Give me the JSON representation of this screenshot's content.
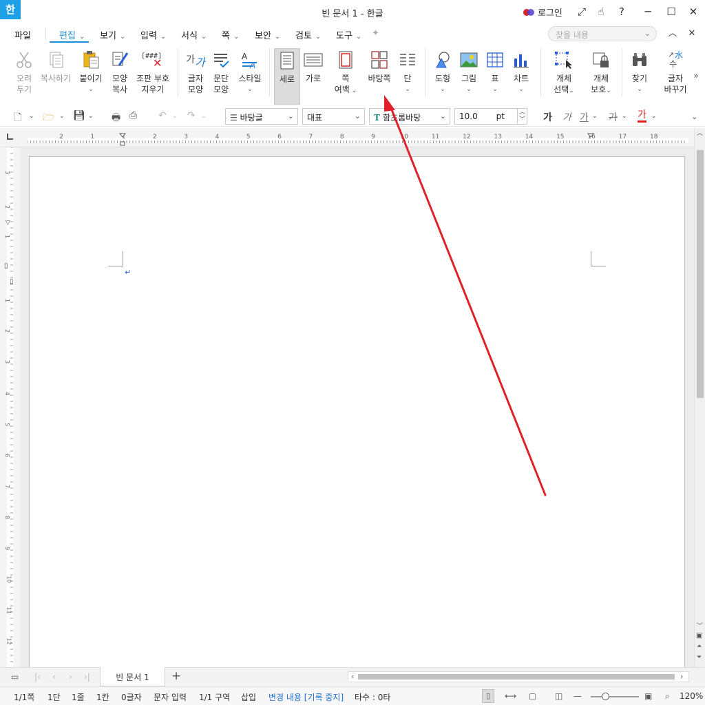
{
  "app": {
    "icon_text": "한",
    "title": "빈 문서 1 - 한글",
    "login": "로그인"
  },
  "menus": [
    {
      "label": "파일",
      "chevron": false
    },
    {
      "label": "편집",
      "chevron": true,
      "active": true
    },
    {
      "label": "보기",
      "chevron": true
    },
    {
      "label": "입력",
      "chevron": true
    },
    {
      "label": "서식",
      "chevron": true
    },
    {
      "label": "쪽",
      "chevron": true
    },
    {
      "label": "보안",
      "chevron": true
    },
    {
      "label": "검토",
      "chevron": true
    },
    {
      "label": "도구",
      "chevron": true
    }
  ],
  "search": {
    "placeholder": "찾을 내용"
  },
  "ribbon": {
    "cut": {
      "line1": "오려",
      "line2": "두기"
    },
    "copy": "복사하기",
    "paste": {
      "line1": "붙이기"
    },
    "format_copy": {
      "line1": "모양",
      "line2": "복사"
    },
    "clear_codes": {
      "line1": "조판 부호",
      "line2": "지우기",
      "icon_text": "[###]"
    },
    "char_shape": {
      "line1": "글자",
      "line2": "모양",
      "icon_text": "가"
    },
    "para_shape": {
      "line1": "문단",
      "line2": "모양"
    },
    "style": {
      "line1": "스타일"
    },
    "portrait": {
      "line1": "세로"
    },
    "landscape": {
      "line1": "가로"
    },
    "margins": {
      "line1": "쪽",
      "line2": "여백"
    },
    "background": {
      "line1": "바탕쪽"
    },
    "columns": {
      "line1": "단"
    },
    "shape": {
      "line1": "도형"
    },
    "picture": {
      "line1": "그림"
    },
    "table": {
      "line1": "표"
    },
    "chart": {
      "line1": "차트"
    },
    "obj_select": {
      "line1": "개체",
      "line2": "선택"
    },
    "obj_protect": {
      "line1": "개체",
      "line2": "보호"
    },
    "find": {
      "line1": "찾기"
    },
    "replace": {
      "line1": "글자",
      "line2": "바꾸기",
      "icon_text": "水",
      "icon_sub": "수"
    }
  },
  "toolbar2": {
    "style_value": "바탕글",
    "lang_value": "대표",
    "font_value": "함초롬바탕",
    "size_value": "10.0",
    "size_unit": "pt",
    "bold": "가",
    "italic": "가",
    "underline": "가",
    "strike": "가",
    "color": "가"
  },
  "ruler": {
    "ticks": [
      "2",
      "1",
      "1",
      "2",
      "3",
      "4",
      "5",
      "6",
      "7",
      "8",
      "9",
      "10",
      "11",
      "12",
      "13",
      "14",
      "15",
      "16",
      "17",
      "18"
    ],
    "vticks": [
      "3",
      "2",
      "1",
      "1",
      "2",
      "3",
      "4",
      "5",
      "6",
      "7",
      "8",
      "9",
      "10",
      "11",
      "12"
    ]
  },
  "doc_tab": "빈 문서 1",
  "status": {
    "page": "1/1쪽",
    "col": "1단",
    "line": "1줄",
    "pos": "1칸",
    "chars": "0글자",
    "input": "문자 입력",
    "section": "1/1 구역",
    "mode": "삽입",
    "track": "변경 내용 [기록 중지]",
    "typing": "타수 : 0타",
    "zoom": "120%"
  },
  "colors": {
    "accent": "#1e8ed8",
    "arrow": "#e0202a",
    "title_icon": "#1ea0e6"
  }
}
